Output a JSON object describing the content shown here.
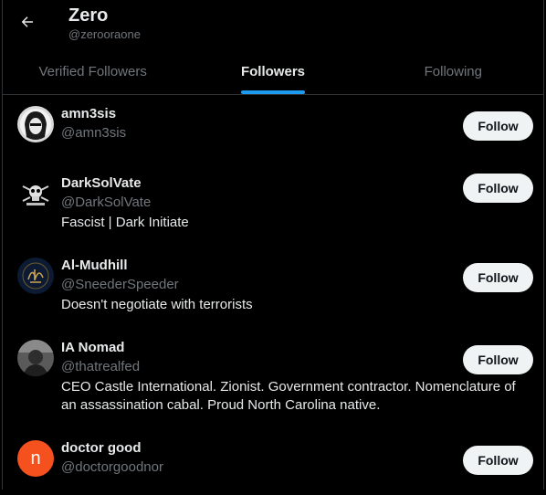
{
  "header": {
    "back_icon": "arrow-left-icon",
    "title": "Zero",
    "handle": "@zerooraone"
  },
  "tabs": [
    {
      "label": "Verified Followers",
      "active": false
    },
    {
      "label": "Followers",
      "active": true
    },
    {
      "label": "Following",
      "active": false
    }
  ],
  "colors": {
    "background": "#000000",
    "accent": "#1d9bf0",
    "text_primary": "#e7e9ea",
    "text_secondary": "#71767b",
    "button_bg": "#eff3f4",
    "divider": "#2f3336"
  },
  "followers": [
    {
      "name": "amn3sis",
      "handle": "@amn3sis",
      "bio": "",
      "button": "Follow",
      "avatar": "profile-photo-dark-hair"
    },
    {
      "name": "DarkSolVate",
      "handle": "@DarkSolVate",
      "bio": "Fascist | Dark Initiate",
      "button": "Follow",
      "avatar": "skull-emblem"
    },
    {
      "name": "Al-Mudhill",
      "handle": "@SneederSpeeder",
      "bio": "Doesn't negotiate with terrorists",
      "button": "Follow",
      "avatar": "gold-calligraphy-emblem"
    },
    {
      "name": "IA Nomad",
      "handle": "@thatrealfed",
      "bio": "CEO Castle International. Zionist. Government contractor. Nomenclature of an assassination cabal. Proud North Carolina native.",
      "button": "Follow",
      "avatar": "grayscale-portrait"
    },
    {
      "name": "doctor good",
      "handle": "@doctorgoodnor",
      "bio": "",
      "button": "Follow",
      "avatar_letter": "n",
      "avatar": "letter-avatar-orange"
    }
  ]
}
